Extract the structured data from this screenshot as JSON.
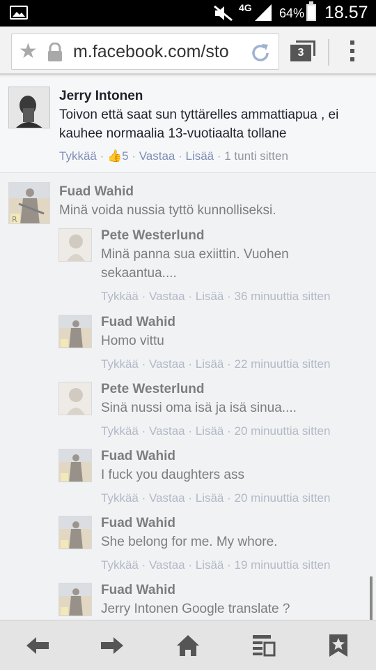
{
  "status_bar": {
    "network": "4G",
    "battery": "64%",
    "battery_level": 0.64,
    "time": "18.57"
  },
  "browser": {
    "url": "m.facebook.com/sto",
    "tab_count": "3"
  },
  "comments": [
    {
      "author": "Jerry Intonen",
      "text": "Toivon että saat sun tyttärelles ammattiapua , ei kauhee normaalia 13-vuotiaalta tollane",
      "actions": {
        "like": "Tykkää",
        "likes": "5",
        "reply": "Vastaa",
        "more": "Lisää",
        "time": "1 tunti sitten"
      }
    },
    {
      "author": "Fuad Wahid",
      "text": "Minä voida nussia tyttö kunnolliseksi.",
      "replies": [
        {
          "author": "Pete Westerlund",
          "text": "Minä panna sua exiittin. Vuohen sekaantua....",
          "actions": {
            "like": "Tykkää",
            "reply": "Vastaa",
            "more": "Lisää",
            "time": "36 minuuttia sitten"
          }
        },
        {
          "author": "Fuad Wahid",
          "text": "Homo vittu",
          "actions": {
            "like": "Tykkää",
            "reply": "Vastaa",
            "more": "Lisää",
            "time": "22 minuuttia sitten"
          }
        },
        {
          "author": "Pete Westerlund",
          "text": "Sinä nussi oma isä ja isä sinua....",
          "actions": {
            "like": "Tykkää",
            "reply": "Vastaa",
            "more": "Lisää",
            "time": "20 minuuttia sitten"
          }
        },
        {
          "author": "Fuad Wahid",
          "text": "I fuck you daughters ass",
          "actions": {
            "like": "Tykkää",
            "reply": "Vastaa",
            "more": "Lisää",
            "time": "20 minuuttia sitten"
          }
        },
        {
          "author": "Fuad Wahid",
          "text": "She belong for me. My whore.",
          "actions": {
            "like": "Tykkää",
            "reply": "Vastaa",
            "more": "Lisää",
            "time": "19 minuuttia sitten"
          }
        },
        {
          "author": "Fuad Wahid",
          "text": "Jerry Intonen Google translate ?"
        }
      ]
    }
  ],
  "icons": {
    "status": [
      "gallery-icon",
      "mute-icon",
      "signal-icon",
      "battery-icon"
    ],
    "url": [
      "bookmark-star-icon",
      "lock-icon",
      "reload-icon"
    ],
    "bottom": [
      "back-arrow-icon",
      "forward-arrow-icon",
      "home-icon",
      "reader-mode-icon",
      "bookmarks-icon"
    ]
  },
  "colors": {
    "link": "#7f8eb5",
    "text": "#1d2129",
    "status_bar": "#000000"
  }
}
